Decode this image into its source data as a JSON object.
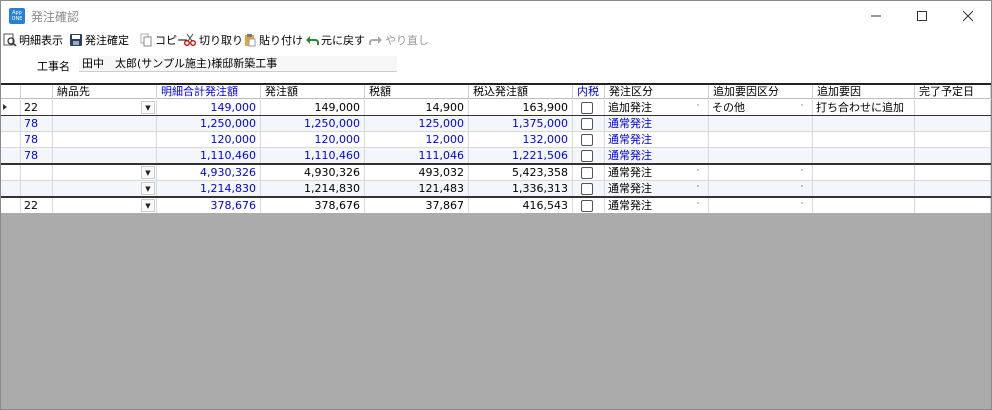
{
  "window": {
    "title": "発注確認",
    "app_icon_label": "App ONE"
  },
  "toolbar": {
    "detail_label": "明細表示",
    "confirm_label": "発注確定",
    "copy_label": "コピー",
    "cut_label": "切り取り",
    "paste_label": "貼り付け",
    "undo_label": "元に戻す",
    "redo_label": "やり直し"
  },
  "project": {
    "label": "工事名",
    "value": "田中　太郎(サンプル施主)様邸新築工事"
  },
  "grid": {
    "columns": [
      "",
      "納品先",
      "明細合計発注額",
      "発注額",
      "税額",
      "税込発注額",
      "内税",
      "発注区分",
      "追加要因区分",
      "追加要因",
      "完了予定日"
    ],
    "rows": [
      {
        "code": "22",
        "total": "149,000",
        "amount": "149,000",
        "tax": "14,900",
        "incl": "163,900",
        "type": "追加発注",
        "reason_type": "その他",
        "reason": "打ち合わせに追加",
        "blue": false
      },
      {
        "code": "78",
        "total": "1,250,000",
        "amount": "1,250,000",
        "tax": "125,000",
        "incl": "1,375,000",
        "type": "通常発注",
        "reason_type": "",
        "reason": "",
        "blue": true
      },
      {
        "code": "78",
        "total": "120,000",
        "amount": "120,000",
        "tax": "12,000",
        "incl": "132,000",
        "type": "通常発注",
        "reason_type": "",
        "reason": "",
        "blue": true
      },
      {
        "code": "78",
        "total": "1,110,460",
        "amount": "1,110,460",
        "tax": "111,046",
        "incl": "1,221,506",
        "type": "通常発注",
        "reason_type": "",
        "reason": "",
        "blue": true
      },
      {
        "code": "",
        "total": "4,930,326",
        "amount": "4,930,326",
        "tax": "493,032",
        "incl": "5,423,358",
        "type": "通常発注",
        "reason_type": "",
        "reason": "",
        "blue": false
      },
      {
        "code": "",
        "total": "1,214,830",
        "amount": "1,214,830",
        "tax": "121,483",
        "incl": "1,336,313",
        "type": "通常発注",
        "reason_type": "",
        "reason": "",
        "blue": false
      },
      {
        "code": "22",
        "total": "378,676",
        "amount": "378,676",
        "tax": "37,867",
        "incl": "416,543",
        "type": "通常発注",
        "reason_type": "",
        "reason": "",
        "blue": false
      }
    ]
  },
  "colors": {
    "accent_blue": "#0000ee",
    "empty_area": "#ababab"
  }
}
